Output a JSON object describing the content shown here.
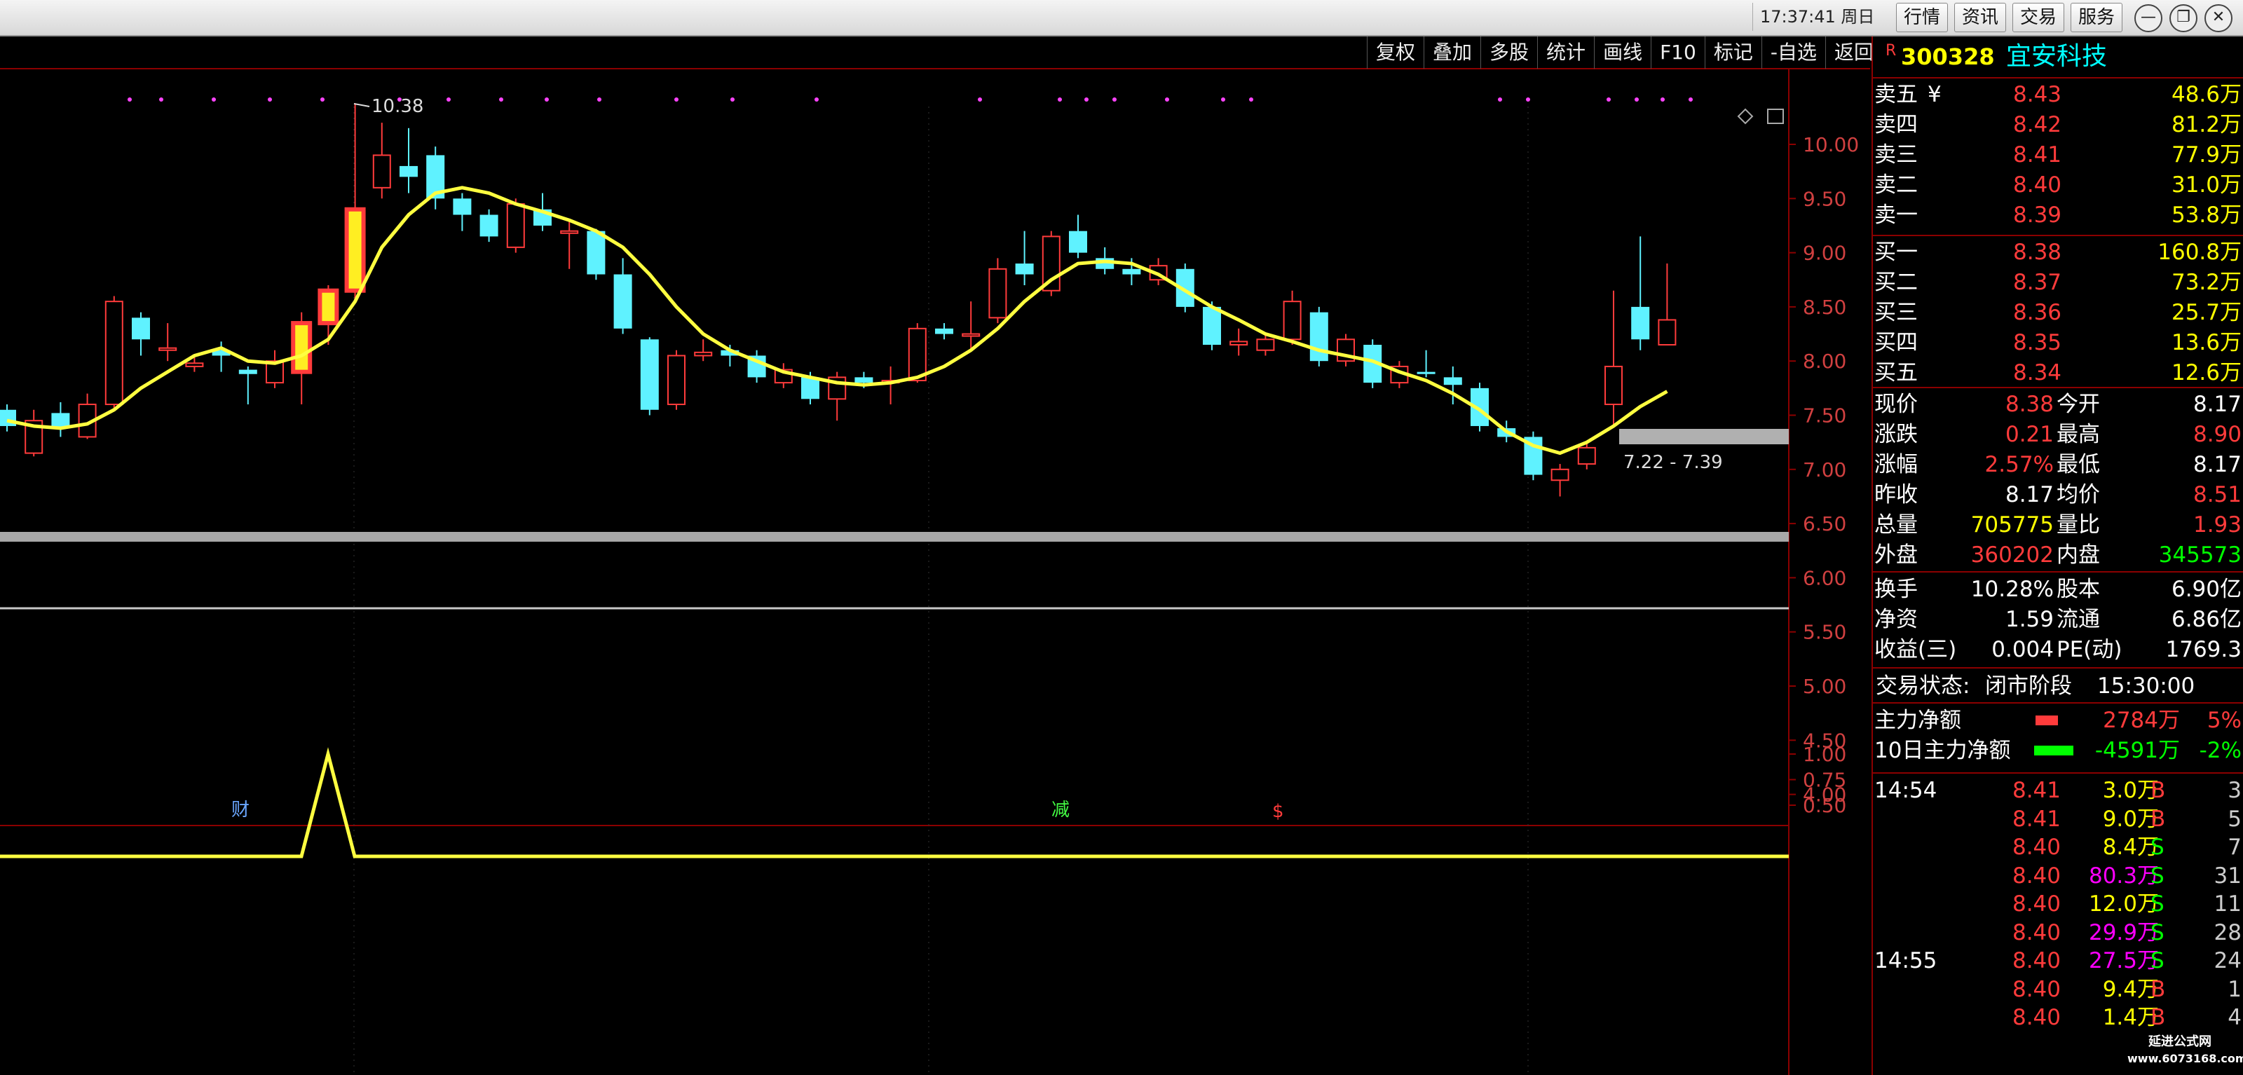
{
  "titlebar": {
    "time": "17:37:41 周日",
    "buttons": [
      "行情",
      "资讯",
      "交易",
      "服务"
    ],
    "controls": [
      "—",
      "❐",
      "✕"
    ]
  },
  "toolbar": [
    "复权",
    "叠加",
    "多股",
    "统计",
    "画线",
    "F10",
    "标记",
    "-自选",
    "返回"
  ],
  "stock": {
    "marker": "R",
    "code": "300328",
    "name": "宜安科技"
  },
  "colors": {
    "up": "#ff3b3b",
    "down": "#5ff2ff",
    "ma": "#ffff40",
    "grid": "#8b0000",
    "panel_text": "#ffff00"
  },
  "price_axis": [
    "10.00",
    "9.50",
    "9.00",
    "8.50",
    "8.00",
    "7.50",
    "7.00",
    "6.50",
    "6.00",
    "5.50",
    "5.00",
    "4.50",
    "4.00"
  ],
  "indicator_axis": [
    "1.00",
    "0.75",
    "0.50"
  ],
  "annotations": {
    "high": "10.38",
    "range": "7.22 - 7.39",
    "event_cai": "财",
    "event_jian": "减",
    "event_s": "$"
  },
  "candles": [
    {
      "o": 7.55,
      "c": 7.4,
      "h": 7.6,
      "l": 7.35
    },
    {
      "o": 7.15,
      "c": 7.45,
      "h": 7.55,
      "l": 7.12
    },
    {
      "o": 7.52,
      "c": 7.38,
      "h": 7.62,
      "l": 7.3
    },
    {
      "o": 7.3,
      "c": 7.6,
      "h": 7.7,
      "l": 7.28
    },
    {
      "o": 7.6,
      "c": 8.55,
      "h": 8.6,
      "l": 7.55
    },
    {
      "o": 8.4,
      "c": 8.2,
      "h": 8.45,
      "l": 8.05
    },
    {
      "o": 8.1,
      "c": 8.12,
      "h": 8.35,
      "l": 8.0
    },
    {
      "o": 7.95,
      "c": 7.98,
      "h": 8.05,
      "l": 7.9
    },
    {
      "o": 8.1,
      "c": 8.05,
      "h": 8.18,
      "l": 7.9
    },
    {
      "o": 7.92,
      "c": 7.88,
      "h": 7.95,
      "l": 7.6
    },
    {
      "o": 7.8,
      "c": 8.0,
      "h": 8.1,
      "l": 7.75
    },
    {
      "o": 7.9,
      "c": 8.35,
      "h": 8.45,
      "l": 7.6
    },
    {
      "o": 8.35,
      "c": 8.65,
      "h": 8.7,
      "l": 8.15
    },
    {
      "o": 8.65,
      "c": 9.4,
      "h": 10.38,
      "l": 8.55
    },
    {
      "o": 9.6,
      "c": 9.9,
      "h": 10.2,
      "l": 9.5
    },
    {
      "o": 9.8,
      "c": 9.7,
      "h": 10.15,
      "l": 9.55
    },
    {
      "o": 9.9,
      "c": 9.5,
      "h": 9.98,
      "l": 9.4
    },
    {
      "o": 9.5,
      "c": 9.35,
      "h": 9.55,
      "l": 9.2
    },
    {
      "o": 9.35,
      "c": 9.15,
      "h": 9.4,
      "l": 9.1
    },
    {
      "o": 9.05,
      "c": 9.45,
      "h": 9.5,
      "l": 9.0
    },
    {
      "o": 9.4,
      "c": 9.25,
      "h": 9.55,
      "l": 9.2
    },
    {
      "o": 9.18,
      "c": 9.2,
      "h": 9.3,
      "l": 8.85
    },
    {
      "o": 9.2,
      "c": 8.8,
      "h": 9.22,
      "l": 8.75
    },
    {
      "o": 8.8,
      "c": 8.3,
      "h": 8.95,
      "l": 8.25
    },
    {
      "o": 8.2,
      "c": 7.55,
      "h": 8.22,
      "l": 7.5
    },
    {
      "o": 7.6,
      "c": 8.05,
      "h": 8.1,
      "l": 7.55
    },
    {
      "o": 8.05,
      "c": 8.08,
      "h": 8.2,
      "l": 8.0
    },
    {
      "o": 8.1,
      "c": 8.05,
      "h": 8.15,
      "l": 7.95
    },
    {
      "o": 8.05,
      "c": 7.85,
      "h": 8.1,
      "l": 7.8
    },
    {
      "o": 7.8,
      "c": 7.92,
      "h": 7.98,
      "l": 7.75
    },
    {
      "o": 7.85,
      "c": 7.65,
      "h": 7.9,
      "l": 7.6
    },
    {
      "o": 7.65,
      "c": 7.85,
      "h": 7.9,
      "l": 7.45
    },
    {
      "o": 7.85,
      "c": 7.8,
      "h": 7.9,
      "l": 7.75
    },
    {
      "o": 7.8,
      "c": 7.82,
      "h": 7.95,
      "l": 7.6
    },
    {
      "o": 7.82,
      "c": 8.3,
      "h": 8.35,
      "l": 7.8
    },
    {
      "o": 8.3,
      "c": 8.25,
      "h": 8.35,
      "l": 8.2
    },
    {
      "o": 8.25,
      "c": 8.25,
      "h": 8.55,
      "l": 8.1
    },
    {
      "o": 8.4,
      "c": 8.85,
      "h": 8.95,
      "l": 8.35
    },
    {
      "o": 8.9,
      "c": 8.8,
      "h": 9.2,
      "l": 8.7
    },
    {
      "o": 8.65,
      "c": 9.15,
      "h": 9.2,
      "l": 8.6
    },
    {
      "o": 9.2,
      "c": 9.0,
      "h": 9.35,
      "l": 8.95
    },
    {
      "o": 8.95,
      "c": 8.85,
      "h": 9.05,
      "l": 8.8
    },
    {
      "o": 8.85,
      "c": 8.8,
      "h": 8.95,
      "l": 8.7
    },
    {
      "o": 8.75,
      "c": 8.88,
      "h": 8.95,
      "l": 8.7
    },
    {
      "o": 8.85,
      "c": 8.5,
      "h": 8.9,
      "l": 8.45
    },
    {
      "o": 8.5,
      "c": 8.15,
      "h": 8.55,
      "l": 8.1
    },
    {
      "o": 8.15,
      "c": 8.18,
      "h": 8.3,
      "l": 8.05
    },
    {
      "o": 8.1,
      "c": 8.2,
      "h": 8.25,
      "l": 8.05
    },
    {
      "o": 8.2,
      "c": 8.55,
      "h": 8.65,
      "l": 8.15
    },
    {
      "o": 8.45,
      "c": 8.0,
      "h": 8.5,
      "l": 7.95
    },
    {
      "o": 8.0,
      "c": 8.2,
      "h": 8.25,
      "l": 7.95
    },
    {
      "o": 8.15,
      "c": 7.8,
      "h": 8.2,
      "l": 7.75
    },
    {
      "o": 7.8,
      "c": 7.95,
      "h": 8.0,
      "l": 7.75
    },
    {
      "o": 7.9,
      "c": 7.88,
      "h": 8.1,
      "l": 7.85
    },
    {
      "o": 7.85,
      "c": 7.78,
      "h": 7.95,
      "l": 7.6
    },
    {
      "o": 7.75,
      "c": 7.4,
      "h": 7.8,
      "l": 7.35
    },
    {
      "o": 7.38,
      "c": 7.3,
      "h": 7.45,
      "l": 7.25
    },
    {
      "o": 7.3,
      "c": 6.95,
      "h": 7.35,
      "l": 6.9
    },
    {
      "o": 6.9,
      "c": 7.0,
      "h": 7.05,
      "l": 6.75
    },
    {
      "o": 7.05,
      "c": 7.2,
      "h": 7.25,
      "l": 7.0
    },
    {
      "o": 7.6,
      "c": 7.95,
      "h": 8.65,
      "l": 7.4
    },
    {
      "o": 8.5,
      "c": 8.2,
      "h": 9.15,
      "l": 8.1
    },
    {
      "o": 8.15,
      "c": 8.38,
      "h": 8.9,
      "l": 8.17
    }
  ],
  "ma_line": [
    7.45,
    7.4,
    7.38,
    7.42,
    7.55,
    7.75,
    7.9,
    8.05,
    8.12,
    8.0,
    7.98,
    8.05,
    8.2,
    8.55,
    9.05,
    9.35,
    9.55,
    9.6,
    9.55,
    9.45,
    9.38,
    9.3,
    9.2,
    9.05,
    8.8,
    8.5,
    8.25,
    8.1,
    8.0,
    7.9,
    7.85,
    7.8,
    7.78,
    7.8,
    7.85,
    7.95,
    8.1,
    8.3,
    8.55,
    8.75,
    8.9,
    8.92,
    8.9,
    8.8,
    8.65,
    8.5,
    8.38,
    8.25,
    8.18,
    8.1,
    8.05,
    8.0,
    7.9,
    7.82,
    7.7,
    7.55,
    7.35,
    7.22,
    7.15,
    7.25,
    7.4,
    7.58,
    7.72
  ],
  "indicator": [
    0,
    0,
    0,
    0,
    0,
    0,
    0,
    0,
    0,
    0,
    0,
    1,
    0,
    0,
    0,
    0,
    0,
    0,
    0,
    0,
    0,
    0,
    0,
    0,
    0,
    0,
    0,
    0,
    0,
    0,
    0,
    0,
    0,
    0,
    0,
    0,
    0,
    0,
    0,
    0,
    0,
    0,
    0,
    0,
    0,
    0,
    0,
    0,
    0,
    0,
    0,
    0,
    0,
    0,
    0,
    0,
    0,
    0,
    0,
    0,
    0,
    0,
    0
  ],
  "orderbook": {
    "sell": [
      {
        "label": "卖五",
        "price": "8.43",
        "vol": "48.6万"
      },
      {
        "label": "卖四",
        "price": "8.42",
        "vol": "81.2万"
      },
      {
        "label": "卖三",
        "price": "8.41",
        "vol": "77.9万"
      },
      {
        "label": "卖二",
        "price": "8.40",
        "vol": "31.0万"
      },
      {
        "label": "卖一",
        "price": "8.39",
        "vol": "53.8万"
      }
    ],
    "sell_flag": "¥",
    "buy": [
      {
        "label": "买一",
        "price": "8.38",
        "vol": "160.8万"
      },
      {
        "label": "买二",
        "price": "8.37",
        "vol": "73.2万"
      },
      {
        "label": "买三",
        "price": "8.36",
        "vol": "25.7万"
      },
      {
        "label": "买四",
        "price": "8.35",
        "vol": "13.6万"
      },
      {
        "label": "买五",
        "price": "8.34",
        "vol": "12.6万"
      }
    ]
  },
  "stats": [
    {
      "l1": "现价",
      "v1": "8.38",
      "c1": "red",
      "l2": "今开",
      "v2": "8.17",
      "c2": "white"
    },
    {
      "l1": "涨跌",
      "v1": "0.21",
      "c1": "red",
      "l2": "最高",
      "v2": "8.90",
      "c2": "red"
    },
    {
      "l1": "涨幅",
      "v1": "2.57%",
      "c1": "red",
      "l2": "最低",
      "v2": "8.17",
      "c2": "white"
    },
    {
      "l1": "昨收",
      "v1": "8.17",
      "c1": "white",
      "l2": "均价",
      "v2": "8.51",
      "c2": "red"
    },
    {
      "l1": "总量",
      "v1": "705775",
      "c1": "yellow",
      "l2": "量比",
      "v2": "1.93",
      "c2": "red"
    },
    {
      "l1": "外盘",
      "v1": "360202",
      "c1": "red",
      "l2": "内盘",
      "v2": "345573",
      "c2": "green"
    }
  ],
  "fundamentals": [
    {
      "l1": "换手",
      "v1": "10.28%",
      "l2": "股本",
      "v2": "6.90亿"
    },
    {
      "l1": "净资",
      "v1": "1.59",
      "l2": "流通",
      "v2": "6.86亿"
    },
    {
      "l1": "收益(三)",
      "v1": "0.004",
      "l2": "PE(动)",
      "v2": "1769.3"
    }
  ],
  "trade_status": {
    "label": "交易状态:",
    "value": "闭市阶段",
    "time": "15:30:00"
  },
  "capital_flow": [
    {
      "label": "主力净额",
      "amount": "2784万",
      "pct": "5%",
      "color": "red"
    },
    {
      "label": "10日主力净额",
      "amount": "-4591万",
      "pct": "-2%",
      "color": "green"
    }
  ],
  "ticks": [
    {
      "time": "14:54",
      "price": "8.41",
      "vol": "3.0万",
      "side": "B",
      "n": "3",
      "vc": "yellow"
    },
    {
      "time": "",
      "price": "8.41",
      "vol": "9.0万",
      "side": "B",
      "n": "5",
      "vc": "yellow"
    },
    {
      "time": "",
      "price": "8.40",
      "vol": "8.4万",
      "side": "S",
      "n": "7",
      "vc": "yellow"
    },
    {
      "time": "",
      "price": "8.40",
      "vol": "80.3万",
      "side": "S",
      "n": "31",
      "vc": "magenta"
    },
    {
      "time": "",
      "price": "8.40",
      "vol": "12.0万",
      "side": "S",
      "n": "11",
      "vc": "yellow"
    },
    {
      "time": "",
      "price": "8.40",
      "vol": "29.9万",
      "side": "S",
      "n": "28",
      "vc": "magenta"
    },
    {
      "time": "14:55",
      "price": "8.40",
      "vol": "27.5万",
      "side": "S",
      "n": "24",
      "vc": "magenta"
    },
    {
      "time": "",
      "price": "8.40",
      "vol": "9.4万",
      "side": "B",
      "n": "1",
      "vc": "yellow"
    },
    {
      "time": "",
      "price": "8.40",
      "vol": "1.4万",
      "side": "B",
      "n": "4",
      "vc": "yellow"
    }
  ],
  "watermark": {
    "line1": "延进公式网",
    "line2": "www.6073168.com"
  }
}
